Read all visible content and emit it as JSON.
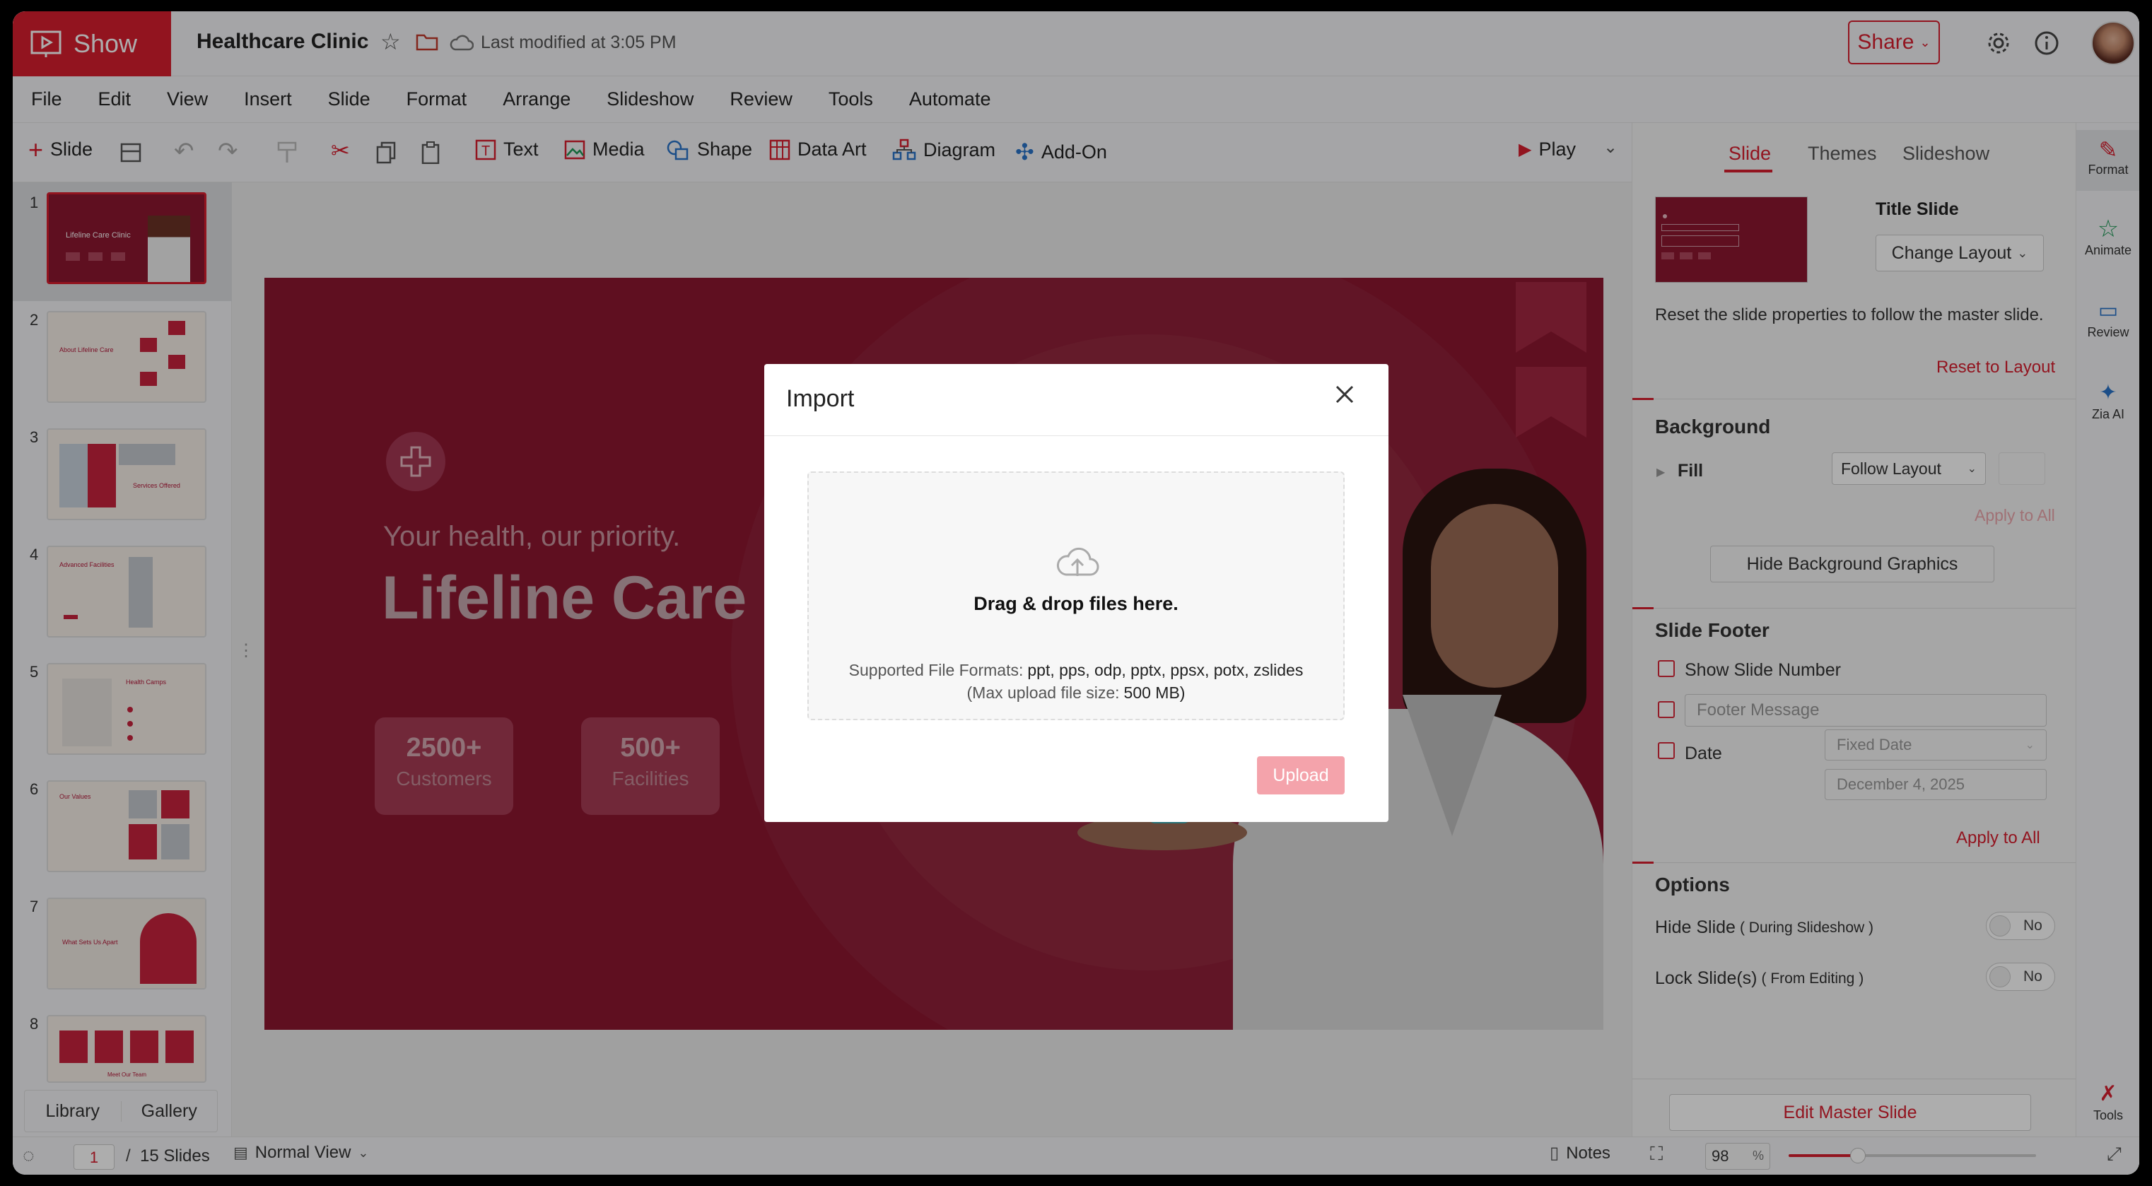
{
  "app": {
    "name": "Show",
    "doc_title": "Healthcare Clinic",
    "last_modified": "Last modified at 3:05 PM",
    "share_label": "Share"
  },
  "menu": [
    "File",
    "Edit",
    "View",
    "Insert",
    "Slide",
    "Format",
    "Arrange",
    "Slideshow",
    "Review",
    "Tools",
    "Automate"
  ],
  "toolbar": {
    "slide_btn": "Slide",
    "text": "Text",
    "media": "Media",
    "shape": "Shape",
    "data_art": "Data Art",
    "diagram": "Diagram",
    "add_on": "Add-On",
    "play": "Play"
  },
  "thumbnails": [
    "1",
    "2",
    "3",
    "4",
    "5",
    "6",
    "7",
    "8"
  ],
  "thumb_titles": {
    "t1": "Lifeline Care Clinic",
    "t2": "About Lifeline Care",
    "t3": "Services Offered",
    "t4": "Advanced Facilities",
    "t5": "Health Camps",
    "t6": "Our Values",
    "t7": "What Sets Us Apart",
    "t8": "Meet Our Team"
  },
  "left_tabs": {
    "library": "Library",
    "gallery": "Gallery"
  },
  "slide": {
    "tagline": "Your health, our priority.",
    "title": "Lifeline Care C",
    "stats": [
      {
        "value": "2500+",
        "label": "Customers"
      },
      {
        "value": "500+",
        "label": "Facilities"
      }
    ]
  },
  "right_panel": {
    "tabs": [
      "Slide",
      "Themes",
      "Slideshow"
    ],
    "layout_name": "Title Slide",
    "change_layout": "Change Layout",
    "reset_desc": "Reset the slide properties to follow the master slide.",
    "reset_link": "Reset to Layout",
    "background_heading": "Background",
    "fill_label": "Fill",
    "fill_value": "Follow Layout",
    "apply_all": "Apply to All",
    "hide_bg": "Hide Background Graphics",
    "footer_heading": "Slide Footer",
    "show_slide_number": "Show Slide Number",
    "footer_placeholder": "Footer Message",
    "date_label": "Date",
    "date_type": "Fixed Date",
    "date_value": "December 4, 2025",
    "apply_all_2": "Apply to All",
    "options_heading": "Options",
    "hide_slide": "Hide Slide",
    "hide_slide_note": "( During Slideshow )",
    "lock_slide": "Lock Slide(s)",
    "lock_slide_note": "( From Editing )",
    "toggle_no": "No",
    "edit_master": "Edit Master Slide"
  },
  "rail": {
    "format": "Format",
    "animate": "Animate",
    "review": "Review",
    "zia": "Zia AI",
    "tools": "Tools"
  },
  "status": {
    "current_slide": "1",
    "separator": "/",
    "total": "15 Slides",
    "view": "Normal View",
    "notes": "Notes",
    "zoom": "98",
    "zoom_unit": "%",
    "zoom_level": 0.28
  },
  "dialog": {
    "title": "Import",
    "drop_text": "Drag & drop files here.",
    "formats_label": "Supported File Formats:",
    "formats": "ppt, pps, odp, pptx, ppsx, potx, zslides",
    "max_label": "(Max upload file size:",
    "max_value": "500 MB)",
    "upload": "Upload"
  },
  "colors": {
    "brand": "#d71e2f",
    "slide_bg": "#8c1730",
    "overlay": "rgba(0,0,0,0.32)",
    "upload_disabled": "#f4a3ab"
  }
}
